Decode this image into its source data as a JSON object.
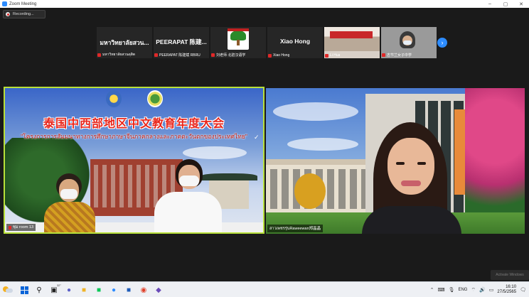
{
  "window": {
    "title": "Zoom Meeting"
  },
  "recording": {
    "label": "Recording..."
  },
  "thumbnails": [
    {
      "big": "มหาวิทยาลัยสวน...",
      "caption": "มหาวิทยาลัยสวนดุสิต",
      "type": "text"
    },
    {
      "big": "PEERAPAT 陈建...",
      "caption": "PEERAPAT 陈建斌 RBRU",
      "type": "text"
    },
    {
      "big": "",
      "caption": "刘老师 北碧汉语学",
      "type": "logo"
    },
    {
      "big": "Xiao Hong",
      "caption": "Xiao Hong",
      "type": "text"
    },
    {
      "big": "",
      "caption": "Li Hua",
      "type": "video1"
    },
    {
      "big": "",
      "caption": "志节兰女子中学",
      "type": "video2"
    }
  ],
  "main_left": {
    "banner_cn": "泰国中西部地区中文教育年度大会",
    "banner_th": "\"โครงการการสัมมนาทางการศึกษาภาษาจีนภาคกลางและภาคตะวันตกของประเทศไทย\"",
    "tick": "✓",
    "name": "ชุม room 13"
  },
  "main_right": {
    "name": "สาวเพชรรุ่นRaweewan郑晶晶"
  },
  "watermark": {
    "text": "Activate Windows"
  },
  "taskbar": {
    "weather_temp": "32°",
    "language": "ENG",
    "time": "16:10",
    "date": "27/5/2565",
    "apps": [
      "start-icon",
      "search-icon",
      "task-view-icon",
      "chat-icon",
      "file-explorer-icon",
      "line-icon",
      "zoom-icon",
      "word-icon",
      "chrome-icon",
      "app-icon"
    ]
  },
  "colors": {
    "active_speaker_border": "#b8e03a",
    "zoom_blue": "#2d8cff",
    "banner_red": "#e8261c"
  }
}
